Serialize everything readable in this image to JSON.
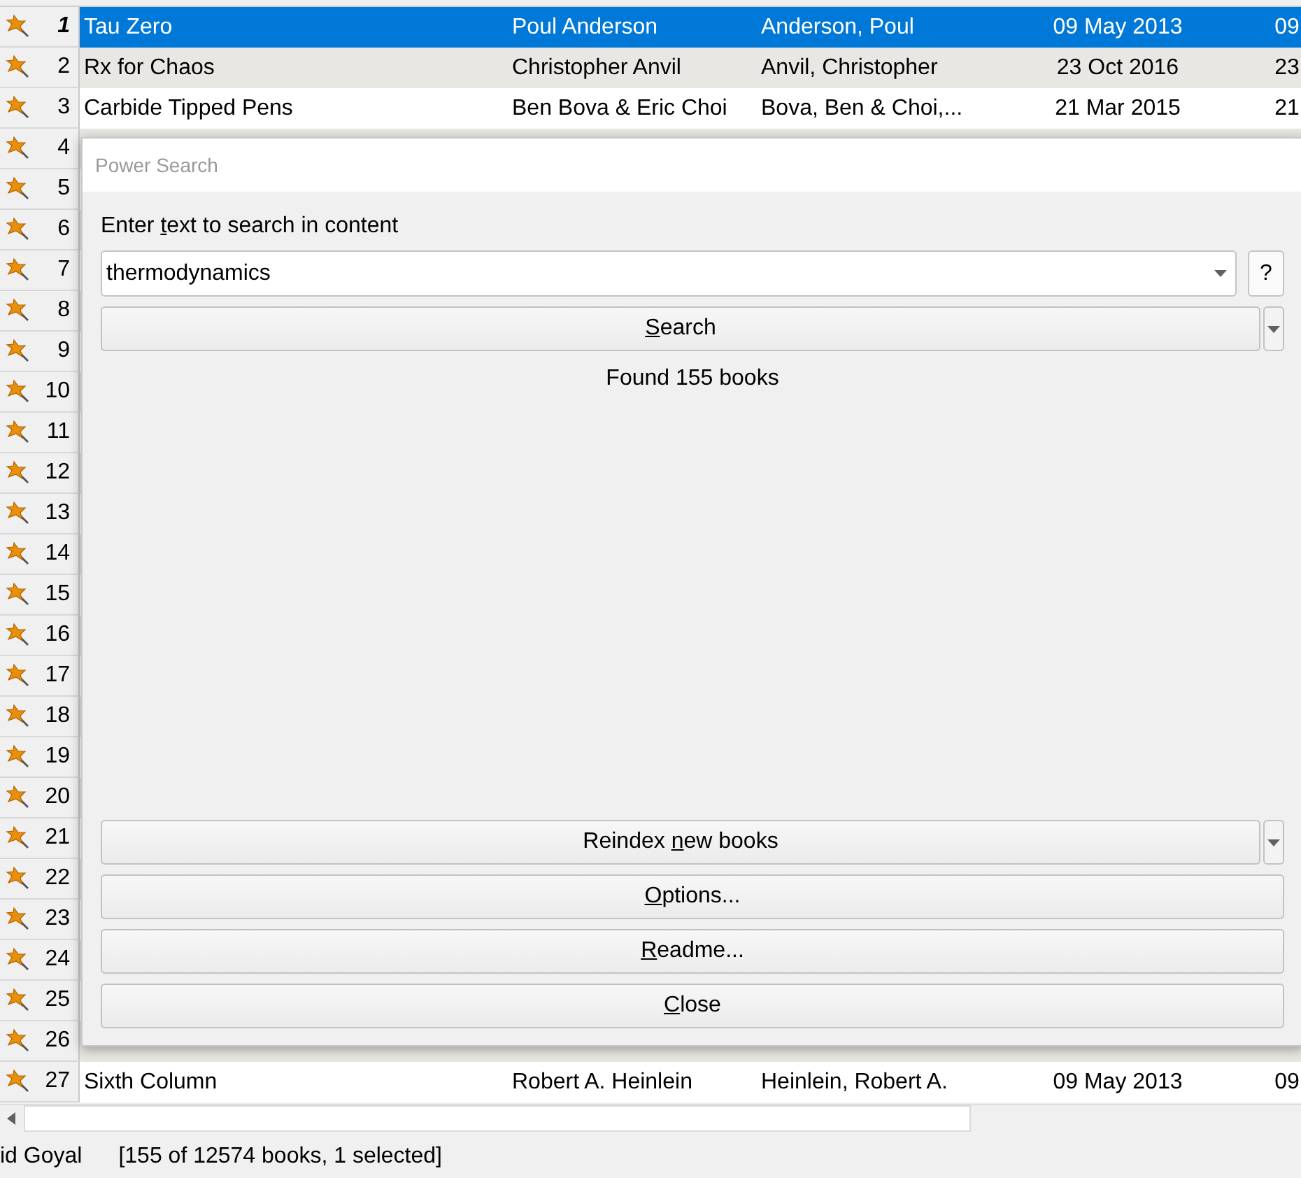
{
  "table": {
    "rows": [
      {
        "number": "1",
        "current": true,
        "selected": true,
        "cells": [
          "Tau Zero",
          "Poul Anderson",
          "Anderson, Poul",
          "09 May 2013",
          "09"
        ]
      },
      {
        "number": "2",
        "current": false,
        "selected": false,
        "cells": [
          "Rx for Chaos",
          "Christopher Anvil",
          "Anvil, Christopher",
          "23 Oct 2016",
          "23"
        ]
      },
      {
        "number": "3",
        "current": false,
        "selected": false,
        "cells": [
          "Carbide Tipped Pens",
          "Ben Bova & Eric Choi",
          "Bova, Ben & Choi,...",
          "21 Mar 2015",
          "21"
        ]
      },
      {
        "number": "4",
        "current": false,
        "selected": false
      },
      {
        "number": "5",
        "current": false,
        "selected": false
      },
      {
        "number": "6",
        "current": false,
        "selected": false
      },
      {
        "number": "7",
        "current": false,
        "selected": false
      },
      {
        "number": "8",
        "current": false,
        "selected": false
      },
      {
        "number": "9",
        "current": false,
        "selected": false
      },
      {
        "number": "10",
        "current": false,
        "selected": false
      },
      {
        "number": "11",
        "current": false,
        "selected": false
      },
      {
        "number": "12",
        "current": false,
        "selected": false
      },
      {
        "number": "13",
        "current": false,
        "selected": false
      },
      {
        "number": "14",
        "current": false,
        "selected": false
      },
      {
        "number": "15",
        "current": false,
        "selected": false
      },
      {
        "number": "16",
        "current": false,
        "selected": false
      },
      {
        "number": "17",
        "current": false,
        "selected": false
      },
      {
        "number": "18",
        "current": false,
        "selected": false
      },
      {
        "number": "19",
        "current": false,
        "selected": false
      },
      {
        "number": "20",
        "current": false,
        "selected": false
      },
      {
        "number": "21",
        "current": false,
        "selected": false
      },
      {
        "number": "22",
        "current": false,
        "selected": false
      },
      {
        "number": "23",
        "current": false,
        "selected": false
      },
      {
        "number": "24",
        "current": false,
        "selected": false
      },
      {
        "number": "25",
        "current": false,
        "selected": false
      },
      {
        "number": "26",
        "current": false,
        "selected": false
      },
      {
        "number": "27",
        "current": false,
        "selected": false,
        "cells": [
          "Sixth Column",
          "Robert A. Heinlein",
          "Heinlein, Robert A.",
          "09 May 2013",
          "09"
        ]
      }
    ]
  },
  "status_bar": {
    "left": "id Goyal",
    "count": "[155 of 12574 books, 1 selected]"
  },
  "dialog": {
    "title": "Power Search",
    "prompt": {
      "before": "Enter ",
      "key": "t",
      "after": "ext to search in content"
    },
    "query": "thermodynamics",
    "help": "?",
    "search_button": {
      "key": "S",
      "after": "earch"
    },
    "result": "Found 155 books",
    "buttons": [
      {
        "before": "Reindex ",
        "key": "n",
        "after": "ew books",
        "kind": "split"
      },
      {
        "key": "O",
        "after": "ptions...",
        "kind": "plain"
      },
      {
        "key": "R",
        "after": "eadme...",
        "kind": "plain"
      },
      {
        "key": "C",
        "after": "lose",
        "kind": "plain"
      }
    ]
  }
}
